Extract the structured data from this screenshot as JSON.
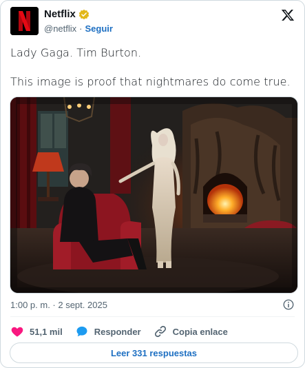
{
  "author": {
    "name": "Netflix",
    "handle": "@netflix",
    "separator": "·",
    "follow_label": "Seguir",
    "brand_color": "#e50914"
  },
  "tweet": {
    "line1": "Lady Gaga. Tim Burton.",
    "line2": "This image is proof that nightmares do come true.",
    "timestamp": "1:00 p. m. · 2 sept. 2025"
  },
  "actions": {
    "likes": "51,1 mil",
    "reply_label": "Responder",
    "copy_label": "Copia enlace"
  },
  "replies_button": "Leer 331 respuestas",
  "icons": [
    "verified-badge-icon",
    "x-logo-icon",
    "info-icon",
    "heart-icon",
    "reply-bubble-icon",
    "link-icon"
  ],
  "colors": {
    "like": "#f91880",
    "reply": "#1d9bf0",
    "link_blue": "#1d6fc2",
    "verified_gold": "#e2b719"
  }
}
